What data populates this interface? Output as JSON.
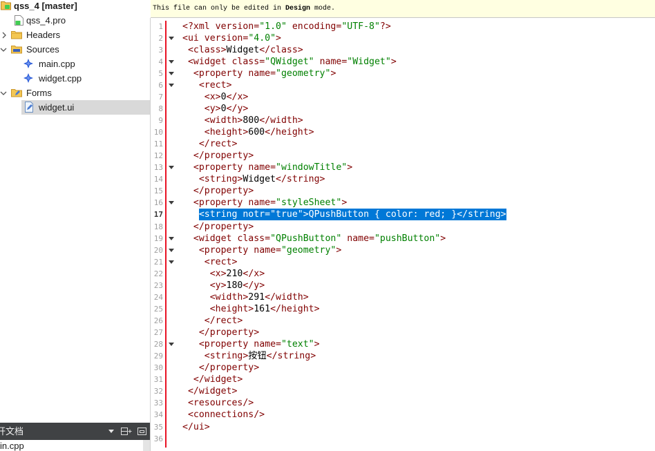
{
  "theme": {
    "tag": "#800000",
    "attr": "#800000",
    "value": "#008000",
    "text": "#000000",
    "selection": "#0078d7",
    "line_number": "#9f9f9f",
    "info_bar": "#ffffe1",
    "tree_selected": "#d9d9d9",
    "panel_dark": "#404244",
    "change_marker": "#e81123"
  },
  "project_tree": {
    "items": [
      {
        "label": "qss_4 [master]",
        "icon": "qt-project-icon",
        "bold": true
      },
      {
        "label": "qss_4.pro",
        "icon": "pro-file-icon"
      },
      {
        "label": "Headers",
        "icon": "folder-icon",
        "expanded": false
      },
      {
        "label": "Sources",
        "icon": "folder-cpp-icon",
        "expanded": true
      },
      {
        "label": "main.cpp",
        "icon": "cpp-file-icon"
      },
      {
        "label": "widget.cpp",
        "icon": "cpp-file-icon"
      },
      {
        "label": "Forms",
        "icon": "folder-forms-icon",
        "expanded": true
      },
      {
        "label": "widget.ui",
        "icon": "ui-file-icon",
        "selected": true
      }
    ]
  },
  "open_documents": {
    "title": "开文档",
    "items": [
      "in.cpp"
    ]
  },
  "info_bar": {
    "prefix": "This file can only be edited in ",
    "emphasis": "Design",
    "suffix": " mode."
  },
  "editor": {
    "lines": [
      {
        "n": "1",
        "code": "<?xml version=\"1.0\" encoding=\"UTF-8\"?>"
      },
      {
        "n": "2",
        "code": "<ui version=\"4.0\">",
        "fold": true
      },
      {
        "n": "3",
        "code": " <class>Widget</class>"
      },
      {
        "n": "4",
        "code": " <widget class=\"QWidget\" name=\"Widget\">",
        "fold": true
      },
      {
        "n": "5",
        "code": "  <property name=\"geometry\">",
        "fold": true
      },
      {
        "n": "6",
        "code": "   <rect>",
        "fold": true
      },
      {
        "n": "7",
        "code": "    <x>0</x>"
      },
      {
        "n": "8",
        "code": "    <y>0</y>"
      },
      {
        "n": "9",
        "code": "    <width>800</width>"
      },
      {
        "n": "10",
        "code": "    <height>600</height>"
      },
      {
        "n": "11",
        "code": "   </rect>"
      },
      {
        "n": "12",
        "code": "  </property>"
      },
      {
        "n": "13",
        "code": "  <property name=\"windowTitle\">",
        "fold": true
      },
      {
        "n": "14",
        "code": "   <string>Widget</string>"
      },
      {
        "n": "15",
        "code": "  </property>"
      },
      {
        "n": "16",
        "code": "  <property name=\"styleSheet\">",
        "fold": true
      },
      {
        "n": "17",
        "code": "   <string notr=\"true\">QPushButton { color: red; }</string>",
        "selected": true,
        "current": true
      },
      {
        "n": "18",
        "code": "  </property>"
      },
      {
        "n": "19",
        "code": "  <widget class=\"QPushButton\" name=\"pushButton\">",
        "fold": true
      },
      {
        "n": "20",
        "code": "   <property name=\"geometry\">",
        "fold": true
      },
      {
        "n": "21",
        "code": "    <rect>",
        "fold": true
      },
      {
        "n": "22",
        "code": "     <x>210</x>"
      },
      {
        "n": "23",
        "code": "     <y>180</y>"
      },
      {
        "n": "24",
        "code": "     <width>291</width>"
      },
      {
        "n": "25",
        "code": "     <height>161</height>"
      },
      {
        "n": "26",
        "code": "    </rect>"
      },
      {
        "n": "27",
        "code": "   </property>"
      },
      {
        "n": "28",
        "code": "   <property name=\"text\">",
        "fold": true
      },
      {
        "n": "29",
        "code": "    <string>按钮</string>"
      },
      {
        "n": "30",
        "code": "   </property>"
      },
      {
        "n": "31",
        "code": "  </widget>"
      },
      {
        "n": "32",
        "code": " </widget>"
      },
      {
        "n": "33",
        "code": " <resources/>"
      },
      {
        "n": "34",
        "code": " <connections/>"
      },
      {
        "n": "35",
        "code": "</ui>"
      },
      {
        "n": "36",
        "code": ""
      }
    ]
  }
}
